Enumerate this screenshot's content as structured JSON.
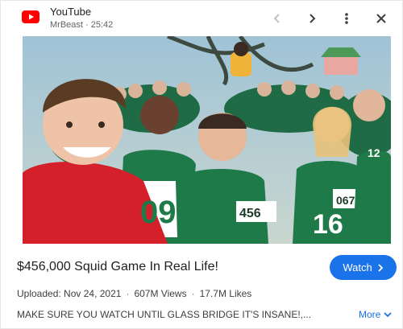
{
  "header": {
    "source": "YouTube",
    "subtitle": "MrBeast · 25:42",
    "icons": [
      "youtube-logo-icon",
      "chevron-left-icon",
      "chevron-right-icon",
      "more-vert-icon",
      "close-icon"
    ]
  },
  "media": {
    "lens_icon": "google-lens-icon",
    "jersey_numbers": [
      "09",
      "456",
      "067",
      "12",
      "16"
    ]
  },
  "video": {
    "title": "$456,000 Squid Game In Real Life!",
    "watch_label": "Watch",
    "uploaded": "Uploaded: Nov 24, 2021",
    "views": "607M Views",
    "likes": "17.7M Likes",
    "description": "MAKE SURE YOU WATCH UNTIL GLASS BRIDGE IT'S INSANE!,...",
    "more_label": "More"
  },
  "colors": {
    "accent": "#1a73e8",
    "youtube_red": "#ff0000",
    "jersey_green": "#1f7a4a"
  }
}
